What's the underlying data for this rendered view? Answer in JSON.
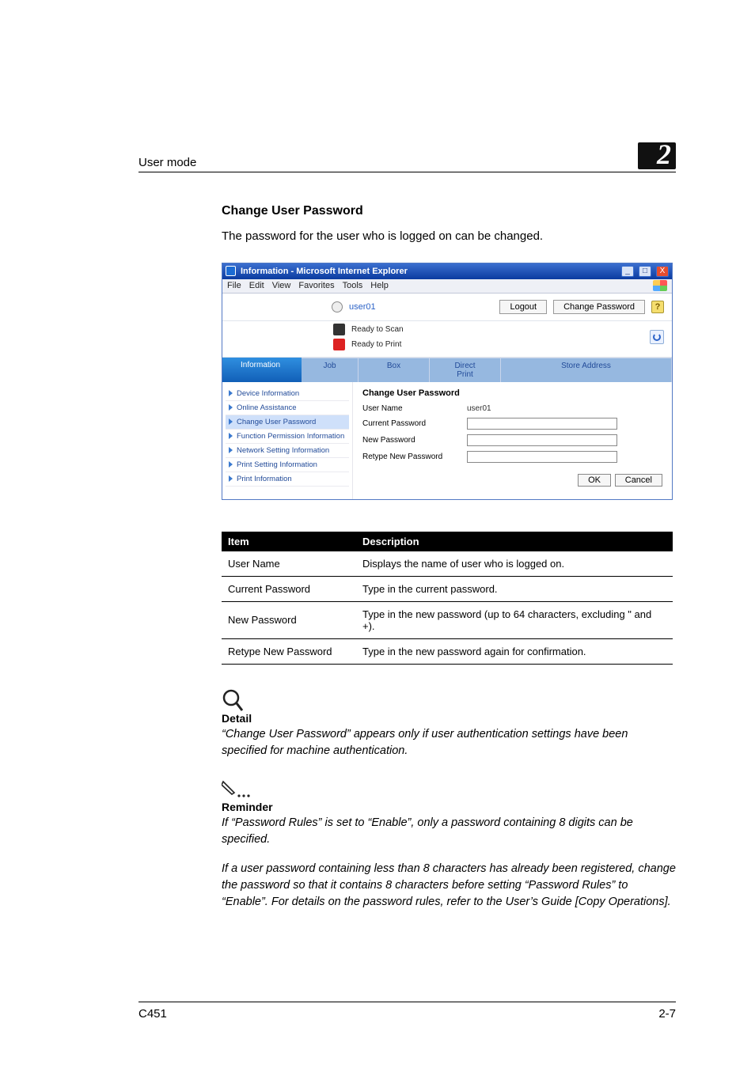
{
  "header": {
    "left": "User mode",
    "chapter": "2"
  },
  "section": {
    "title": "Change User Password",
    "desc": "The password for the user who is logged on can be changed."
  },
  "screenshot": {
    "titlebar": "Information - Microsoft Internet Explorer",
    "menus": {
      "file": "File",
      "edit": "Edit",
      "view": "View",
      "fav": "Favorites",
      "tools": "Tools",
      "help": "Help"
    },
    "user": "user01",
    "buttons": {
      "logout": "Logout",
      "changepw": "Change Password"
    },
    "status": {
      "scan": "Ready to Scan",
      "print": "Ready to Print"
    },
    "tabs": {
      "info": "Information",
      "job": "Job",
      "box": "Box",
      "direct": "Direct Print",
      "store": "Store Address"
    },
    "sidebar": [
      "Device Information",
      "Online Assistance",
      "Change User Password",
      "Function Permission Information",
      "Network Setting Information",
      "Print Setting Information",
      "Print Information"
    ],
    "form": {
      "title": "Change User Password",
      "user_label": "User Name",
      "user_value": "user01",
      "curr_label": "Current Password",
      "new_label": "New Password",
      "retype_label": "Retype New Password",
      "ok": "OK",
      "cancel": "Cancel"
    }
  },
  "table": {
    "head_item": "Item",
    "head_desc": "Description",
    "rows": [
      {
        "item": "User Name",
        "desc": "Displays the name of user who is logged on."
      },
      {
        "item": "Current Password",
        "desc": "Type in the current password."
      },
      {
        "item": "New Password",
        "desc": "Type in the new password (up to 64 characters, excluding \" and +)."
      },
      {
        "item": "Retype New Password",
        "desc": "Type in the new password again for confirmation."
      }
    ]
  },
  "detail": {
    "title": "Detail",
    "body": "“Change User Password” appears only if user authentication settings have been specified for machine authentication."
  },
  "reminder": {
    "title": "Reminder",
    "body1": "If “Password Rules” is set to “Enable”, only a password containing 8 digits can be specified.",
    "body2": "If a user password containing less than 8 characters has already been registered, change the password so that it contains 8 characters before setting “Password Rules” to “Enable”. For details on the password rules, refer to the User’s Guide [Copy Operations]."
  },
  "footer": {
    "left": "C451",
    "right": "2-7"
  }
}
